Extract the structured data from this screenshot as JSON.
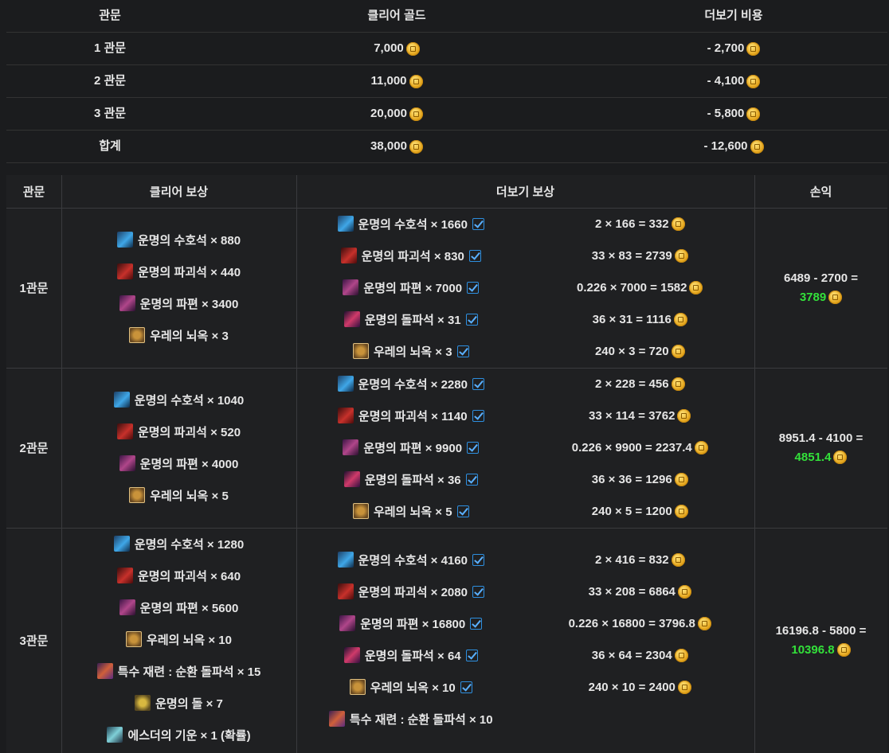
{
  "summary": {
    "headers": [
      "관문",
      "클리어 골드",
      "더보기 비용"
    ],
    "rows": [
      {
        "gate": "1 관문",
        "clear": "7,000",
        "cost": "- 2,700"
      },
      {
        "gate": "2 관문",
        "clear": "11,000",
        "cost": "- 4,100"
      },
      {
        "gate": "3 관문",
        "clear": "20,000",
        "cost": "- 5,800"
      },
      {
        "gate": "합계",
        "clear": "38,000",
        "cost": "- 12,600"
      }
    ]
  },
  "detail": {
    "headers": [
      "관문",
      "클리어 보상",
      "더보기 보상",
      "손익"
    ],
    "gates": [
      {
        "name": "1관문",
        "clear": [
          {
            "icon": "guardian-stone-icon",
            "text": "운명의 수호석 × 880"
          },
          {
            "icon": "destruction-stone-icon",
            "text": "운명의 파괴석 × 440"
          },
          {
            "icon": "shard-icon",
            "text": "운명의 파편 × 3400"
          },
          {
            "icon": "leapstone-icon",
            "text": "우레의 뇌옥 × 3"
          }
        ],
        "more": [
          {
            "icon": "guardian-stone-icon",
            "text": "운명의 수호석 × 1660",
            "calc": "2 × 166 = 332"
          },
          {
            "icon": "destruction-stone-icon",
            "text": "운명의 파괴석 × 830",
            "calc": "33 × 83 = 2739"
          },
          {
            "icon": "shard-icon",
            "text": "운명의 파편 × 7000",
            "calc": "0.226 × 7000 = 1582"
          },
          {
            "icon": "gem-icon",
            "text": "운명의 돌파석 × 31",
            "calc": "36 × 31 = 1116"
          },
          {
            "icon": "leapstone-icon",
            "text": "우레의 뇌옥 × 3",
            "calc": "240 × 3 = 720"
          }
        ],
        "profit_calc": "6489 - 2700 =",
        "profit": "3789"
      },
      {
        "name": "2관문",
        "clear": [
          {
            "icon": "guardian-stone-icon",
            "text": "운명의 수호석 × 1040"
          },
          {
            "icon": "destruction-stone-icon",
            "text": "운명의 파괴석 × 520"
          },
          {
            "icon": "shard-icon",
            "text": "운명의 파편 × 4000"
          },
          {
            "icon": "leapstone-icon",
            "text": "우레의 뇌옥 × 5"
          }
        ],
        "more": [
          {
            "icon": "guardian-stone-icon",
            "text": "운명의 수호석 × 2280",
            "calc": "2 × 228 = 456"
          },
          {
            "icon": "destruction-stone-icon",
            "text": "운명의 파괴석 × 1140",
            "calc": "33 × 114 = 3762"
          },
          {
            "icon": "shard-icon",
            "text": "운명의 파편 × 9900",
            "calc": "0.226 × 9900 = 2237.4"
          },
          {
            "icon": "gem-icon",
            "text": "운명의 돌파석 × 36",
            "calc": "36 × 36 = 1296"
          },
          {
            "icon": "leapstone-icon",
            "text": "우레의 뇌옥 × 5",
            "calc": "240 × 5 = 1200"
          }
        ],
        "profit_calc": "8951.4 - 4100 =",
        "profit": "4851.4"
      },
      {
        "name": "3관문",
        "clear": [
          {
            "icon": "guardian-stone-icon",
            "text": "운명의 수호석 × 1280"
          },
          {
            "icon": "destruction-stone-icon",
            "text": "운명의 파괴석 × 640"
          },
          {
            "icon": "shard-icon",
            "text": "운명의 파편 × 5600"
          },
          {
            "icon": "leapstone-icon",
            "text": "우레의 뇌옥 × 10"
          },
          {
            "icon": "special-refine-icon",
            "text": "특수 재련 : 순환 돌파석 × 15"
          },
          {
            "icon": "fate-stone-icon",
            "text": "운명의 돌 × 7"
          },
          {
            "icon": "esther-energy-icon",
            "text": "에스더의 기운 × 1 (확률)"
          }
        ],
        "more": [
          {
            "icon": "guardian-stone-icon",
            "text": "운명의 수호석 × 4160",
            "calc": "2 × 416 = 832"
          },
          {
            "icon": "destruction-stone-icon",
            "text": "운명의 파괴석 × 2080",
            "calc": "33 × 208 = 6864"
          },
          {
            "icon": "shard-icon",
            "text": "운명의 파편 × 16800",
            "calc": "0.226 × 16800 = 3796.8"
          },
          {
            "icon": "gem-icon",
            "text": "운명의 돌파석 × 64",
            "calc": "36 × 64 = 2304"
          },
          {
            "icon": "leapstone-icon",
            "text": "우레의 뇌옥 × 10",
            "calc": "240 × 10 = 2400"
          },
          {
            "icon": "special-refine-icon",
            "text": "특수 재련 : 순환 돌파석 × 10",
            "calc": ""
          }
        ],
        "profit_calc": "16196.8 - 5800 =",
        "profit": "10396.8"
      }
    ]
  }
}
